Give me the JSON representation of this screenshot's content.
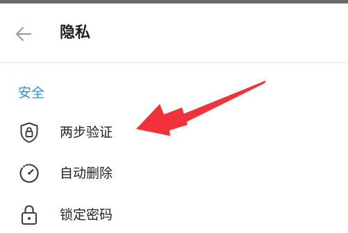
{
  "header": {
    "title": "隐私",
    "back_icon": "arrow-left-icon"
  },
  "section": {
    "title": "安全"
  },
  "items": [
    {
      "label": "两步验证",
      "icon": "shield-lock-icon"
    },
    {
      "label": "自动删除",
      "icon": "timer-icon"
    },
    {
      "label": "锁定密码",
      "icon": "lock-icon"
    }
  ],
  "colors": {
    "accent": "#3a8ec7",
    "annotation_arrow": "#f2323a",
    "text": "#222222",
    "icon": "#3b3b3b"
  }
}
